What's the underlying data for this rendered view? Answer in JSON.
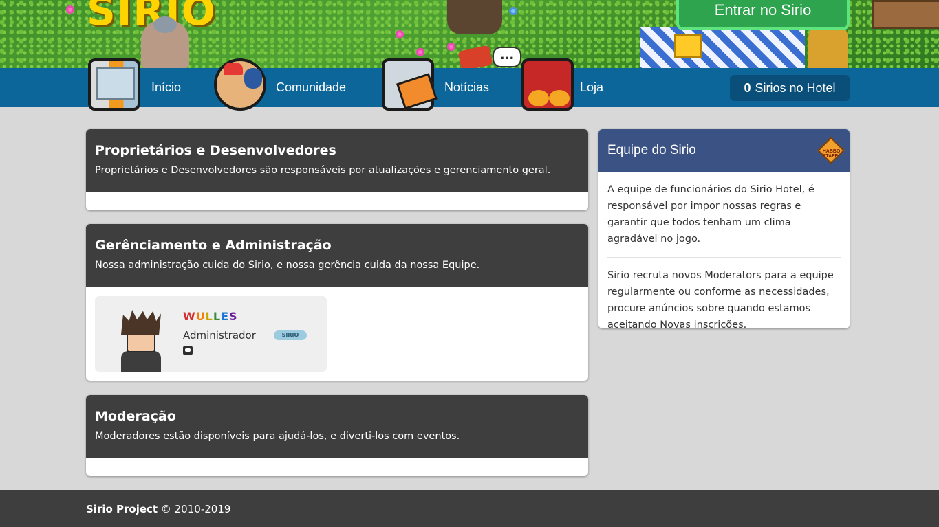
{
  "banner": {
    "logo_text": "SIRIO",
    "enter_button": "Entrar no Sirio",
    "bubble_text": "..."
  },
  "nav": {
    "items": [
      {
        "label": "Início",
        "icon": "home-elevator-icon"
      },
      {
        "label": "Comunidade",
        "icon": "community-people-icon"
      },
      {
        "label": "Notícias",
        "icon": "news-newspaper-icon"
      },
      {
        "label": "Loja",
        "icon": "shop-basket-icon"
      }
    ],
    "online_count": "0",
    "online_label": "Sirios no Hotel"
  },
  "sections": [
    {
      "title": "Proprietários e Desenvolvedores",
      "description": "Proprietários e Desenvolvedores são responsáveis por atualizações e gerenciamento geral."
    },
    {
      "title": "Gerênciamento e Administração",
      "description": "Nossa administração cuida do Sirio, e nossa gerência cuida da nossa Equipe.",
      "members": [
        {
          "name": "WULLES",
          "role": "Administrador",
          "badge": "SIRIO",
          "contact_icon": "discord-icon"
        }
      ]
    },
    {
      "title": "Moderação",
      "description": "Moderadores estão disponíveis para ajudá-los, e diverti-los com eventos."
    }
  ],
  "sidebar": {
    "title": "Equipe do Sirio",
    "badge_text": "HABBO STAFF",
    "paragraph_1": "A equipe de funcionários do Sirio Hotel, é responsável por impor nossas regras e garantir que todos tenham um clima agradável no jogo.",
    "paragraph_2": "Sirio recruta novos Moderators para a equipe regularmente ou conforme as necessidades, procure anúncios sobre quando estamos aceitando Novas inscrições."
  },
  "footer": {
    "brand": "Sirio Project",
    "copyright": "© 2010-2019"
  },
  "colors": {
    "nav": "#0d6699",
    "card_header": "#3e3e3e",
    "sidebar_header": "#3b5284",
    "enter_button": "#2ea44f",
    "background": "#d8d8d8"
  }
}
